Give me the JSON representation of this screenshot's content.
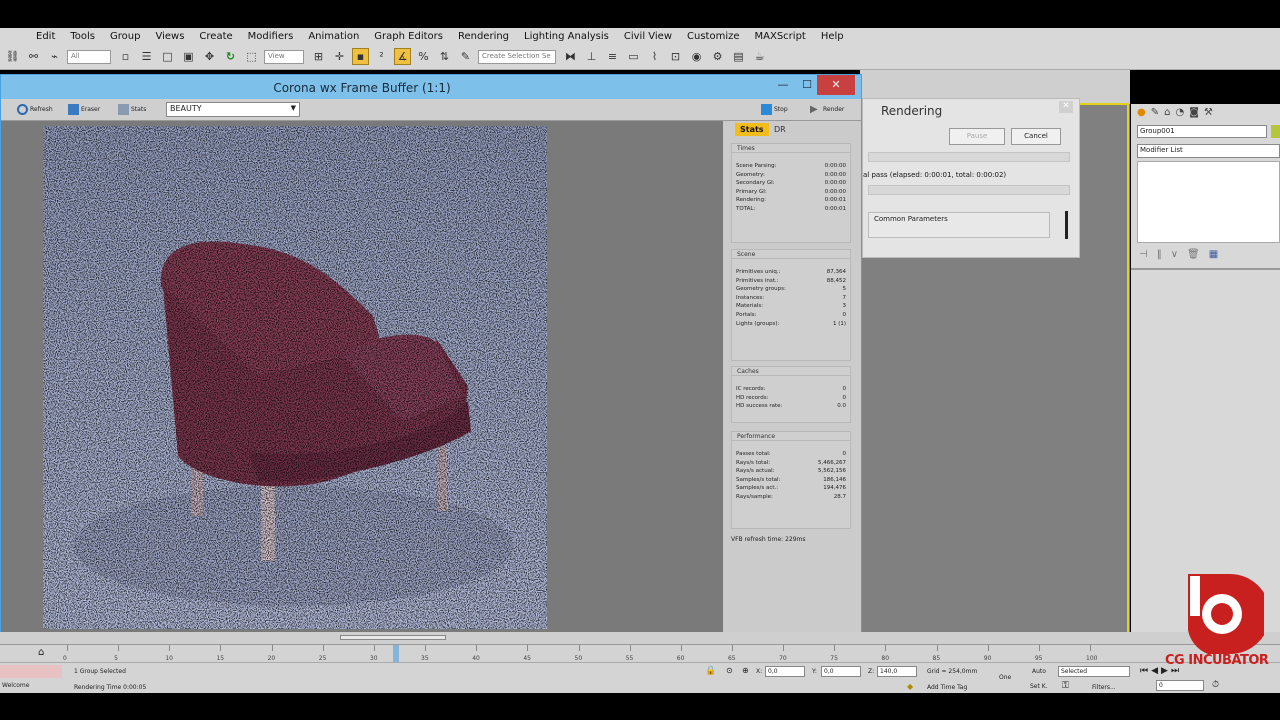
{
  "menu": [
    "Edit",
    "Tools",
    "Group",
    "Views",
    "Create",
    "Modifiers",
    "Animation",
    "Graph Editors",
    "Rendering",
    "Lighting Analysis",
    "Civil View",
    "Customize",
    "MAXScript",
    "Help"
  ],
  "toolbar": {
    "filter_combo": "All",
    "view_combo": "View",
    "selection_set": "Create Selection Se"
  },
  "vfb": {
    "title": "Corona wx Frame Buffer (1:1)",
    "refresh": "Refresh",
    "eraser": "Eraser",
    "stats": "Stats",
    "channel": "BEAUTY",
    "stop": "Stop",
    "render": "Render",
    "tab_stats": "Stats",
    "tab_dr": "DR",
    "footer": "VFB refresh time: 229ms",
    "sections": {
      "times": {
        "title": "Times",
        "rows": [
          [
            "Scene Parsing:",
            "0:00:00"
          ],
          [
            "Geometry:",
            "0:00:00"
          ],
          [
            "Secondary GI:",
            "0:00:00"
          ],
          [
            "Primary GI:",
            "0:00:00"
          ],
          [
            "Rendering:",
            "0:00:01"
          ],
          [
            "TOTAL:",
            "0:00:01"
          ]
        ]
      },
      "scene": {
        "title": "Scene",
        "rows": [
          [
            "Primitives uniq.:",
            "87,364"
          ],
          [
            "Primitives inst.:",
            "88,452"
          ],
          [
            "Geometry groups:",
            "5"
          ],
          [
            "Instances:",
            "7"
          ],
          [
            "Materials:",
            "3"
          ],
          [
            "Portals:",
            "0"
          ],
          [
            "Lights (groups):",
            "1 (1)"
          ]
        ]
      },
      "caches": {
        "title": "Caches",
        "rows": [
          [
            "IC records:",
            "0"
          ],
          [
            "HD records:",
            "0"
          ],
          [
            "HD success rate:",
            "0.0"
          ]
        ]
      },
      "performance": {
        "title": "Performance",
        "rows": [
          [
            "Passes total:",
            "0"
          ],
          [
            "Rays/s total:",
            "5,466,267"
          ],
          [
            "Rays/s actual:",
            "5,562,156"
          ],
          [
            "Samples/s total:",
            "186,146"
          ],
          [
            "Samples/s act.:",
            "194,476"
          ],
          [
            "Rays/sample:",
            "28.7"
          ]
        ]
      }
    }
  },
  "render_dialog": {
    "title": "Rendering",
    "pause": "Pause",
    "cancel": "Cancel",
    "progress_text": "al pass (elapsed: 0:00:01, total: 0:00:02)",
    "common_params": "Common Parameters"
  },
  "command_panel": {
    "object_name": "Group001",
    "modifier_list": "Modifier List",
    "color": "#b6c63a"
  },
  "timeline": {
    "ticks": [
      "0",
      "5",
      "10",
      "15",
      "20",
      "25",
      "30",
      "35",
      "40",
      "45",
      "50",
      "55",
      "60",
      "65",
      "70",
      "75",
      "80",
      "85",
      "90",
      "95",
      "100"
    ]
  },
  "status": {
    "selected": "1 Group Selected",
    "render_time": "Rendering Time  0:00:05",
    "welcome": "Welcome",
    "x_label": "X:",
    "x_val": "0,0",
    "y_label": "Y:",
    "y_val": "0,0",
    "z_label": "Z:",
    "z_val": "140,0",
    "grid": "Grid = 254,0mm",
    "add_time_tag": "Add Time Tag",
    "auto": "Auto",
    "set_k": "Set K.",
    "selected_combo": "Selected",
    "filters": "Filters...",
    "frame": "0",
    "one": "One"
  },
  "logo": {
    "text": "CG INCUBATOR",
    "color": "#c8201e"
  }
}
